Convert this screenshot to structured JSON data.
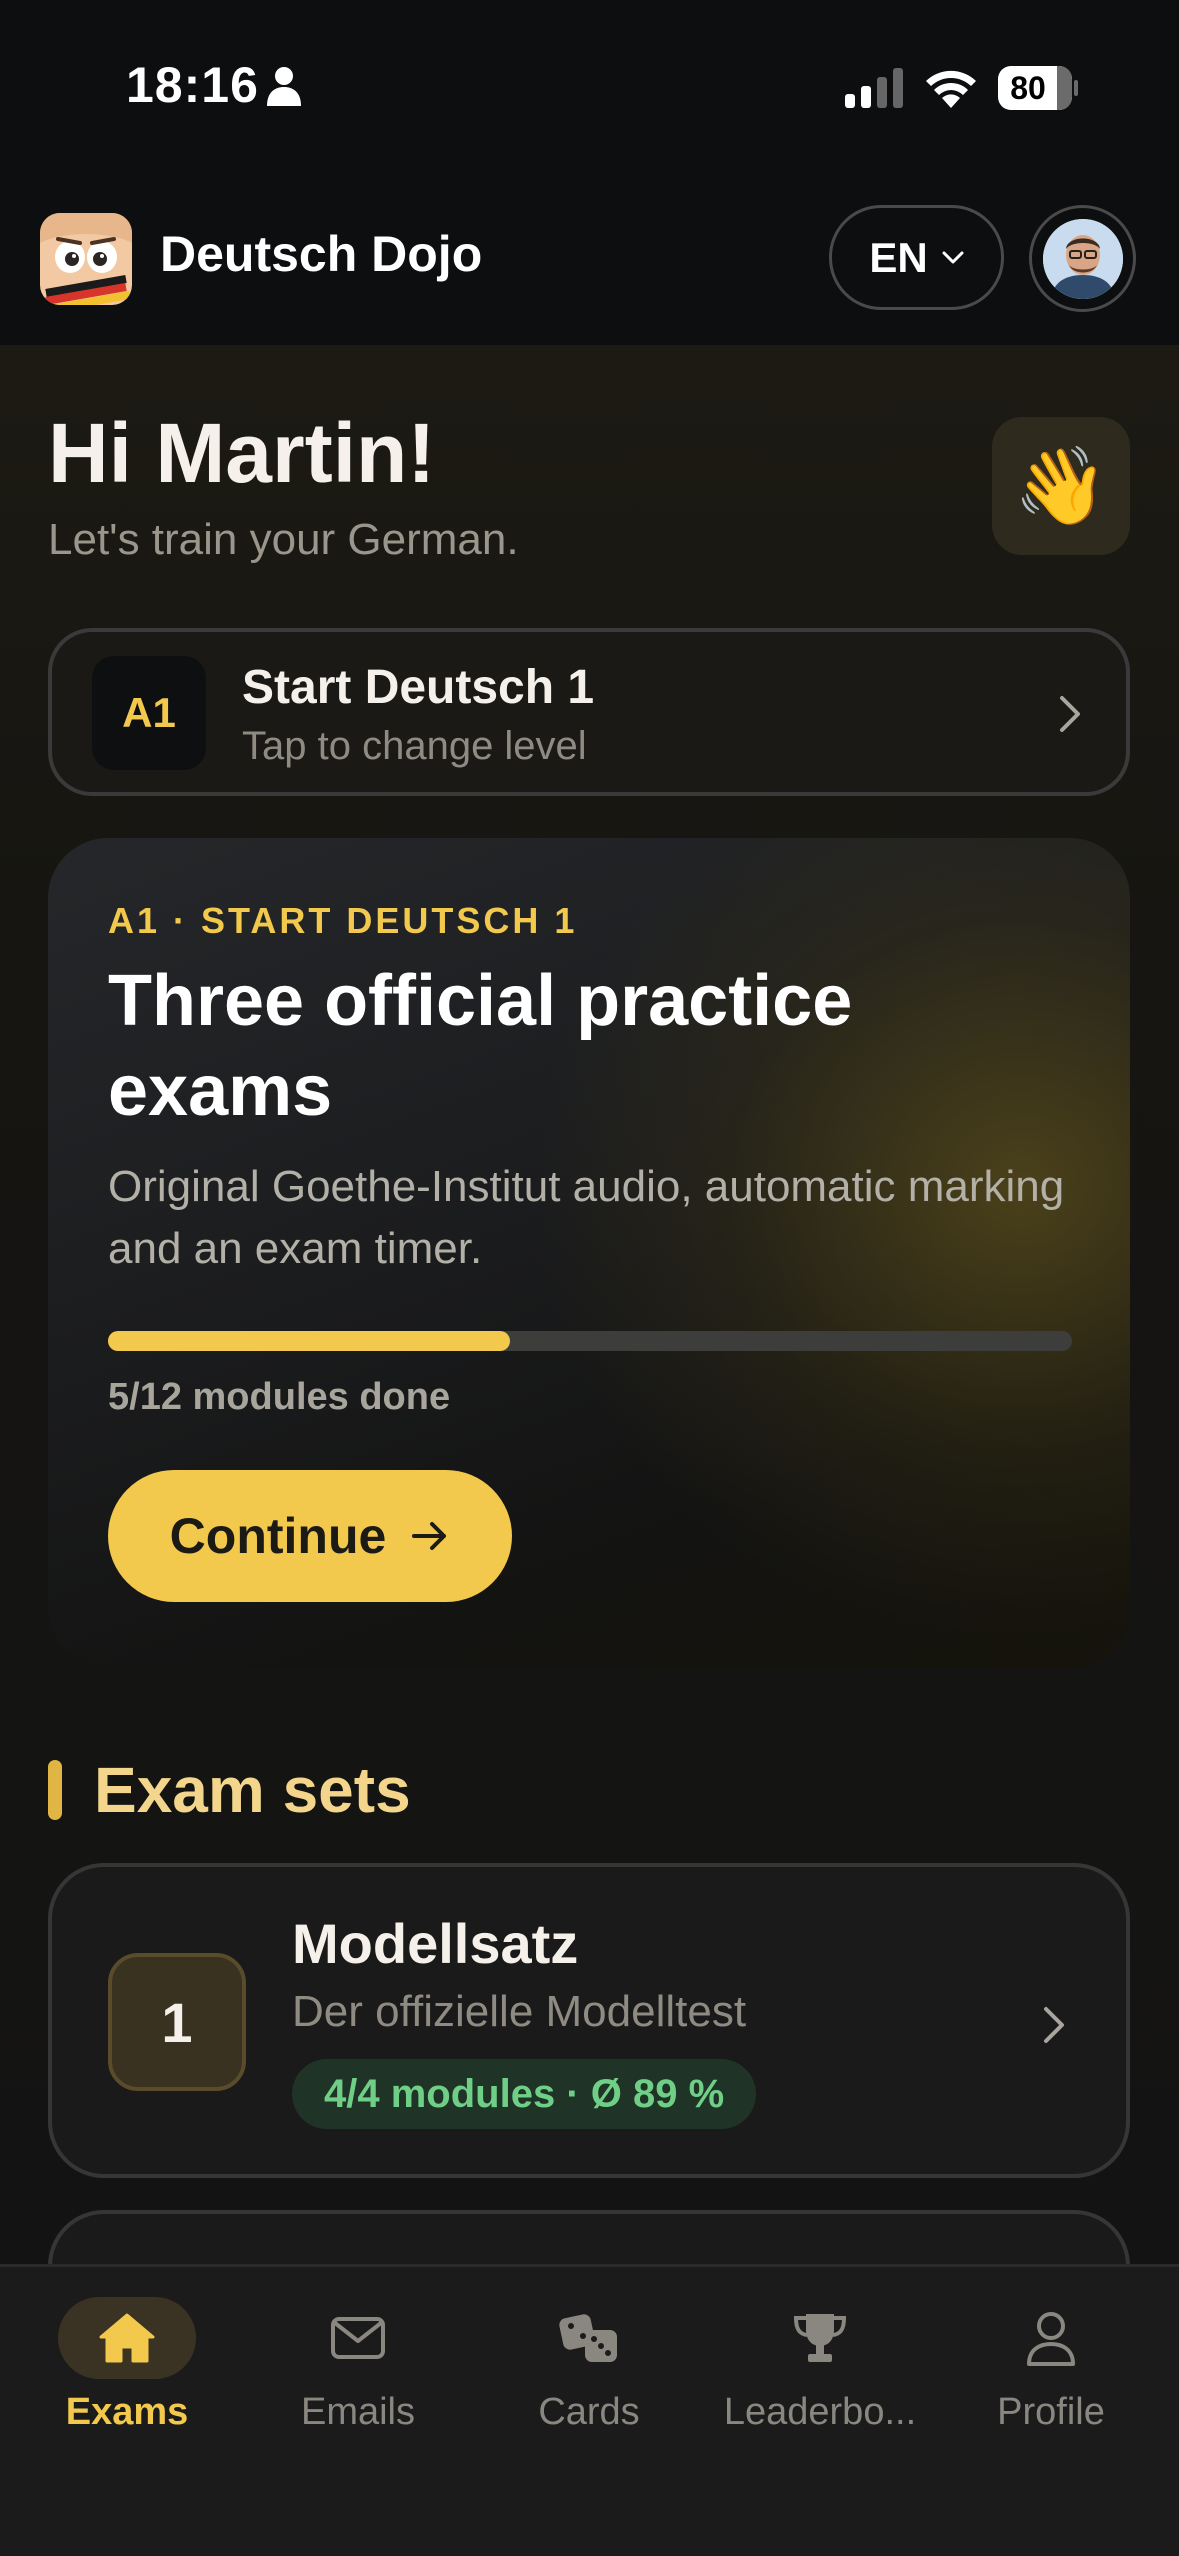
{
  "status_bar": {
    "time": "18:16",
    "battery": "80"
  },
  "app": {
    "title": "Deutsch Dojo",
    "language": "EN"
  },
  "greeting": {
    "title": "Hi Martin!",
    "subtitle": "Let's train your German.",
    "emoji": "👋"
  },
  "level": {
    "badge": "A1",
    "title": "Start Deutsch 1",
    "subtitle": "Tap to change level"
  },
  "hero": {
    "kicker": "A1 · START DEUTSCH 1",
    "title": "Three official practice exams",
    "description": "Original Goethe-Institut audio, automatic marking and an exam timer.",
    "progress_done": 5,
    "progress_total": 12,
    "progress_text": "5/12 modules done",
    "button_label": "Continue"
  },
  "exam_sets": {
    "title": "Exam sets",
    "items": [
      {
        "number": "1",
        "title": "Modellsatz",
        "subtitle": "Der offizielle Modelltest",
        "status": "4/4 modules · Ø 89 %"
      }
    ]
  },
  "tabs": [
    {
      "label": "Exams",
      "icon": "home-icon",
      "active": true
    },
    {
      "label": "Emails",
      "icon": "mail-icon",
      "active": false
    },
    {
      "label": "Cards",
      "icon": "dice-icon",
      "active": false
    },
    {
      "label": "Leaderbo...",
      "icon": "trophy-icon",
      "active": false
    },
    {
      "label": "Profile",
      "icon": "person-icon",
      "active": false
    }
  ],
  "colors": {
    "accent": "#f2c94c",
    "success": "#6fcf86",
    "background": "#131313"
  }
}
